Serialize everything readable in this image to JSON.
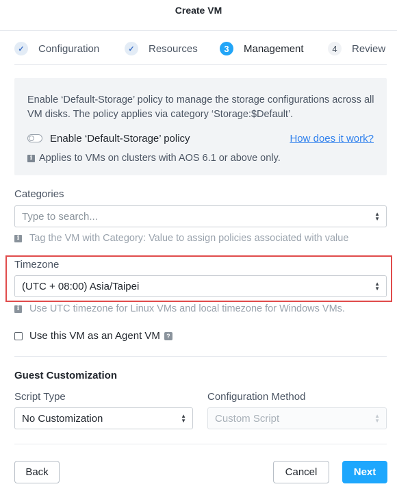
{
  "dialog": {
    "title": "Create VM"
  },
  "steps": [
    {
      "number": "✓",
      "label": "Configuration",
      "state": "done"
    },
    {
      "number": "✓",
      "label": "Resources",
      "state": "done"
    },
    {
      "number": "3",
      "label": "Management",
      "state": "active"
    },
    {
      "number": "4",
      "label": "Review",
      "state": "pending"
    }
  ],
  "storage_policy": {
    "description": "Enable ‘Default-Storage’ policy to manage the storage configurations across all VM disks. The policy applies via category ‘Storage:$Default’.",
    "toggle_label": "Enable ‘Default-Storage’ policy",
    "toggle_on": false,
    "help_link": "How does it work?",
    "note": "Applies to VMs on clusters with AOS 6.1 or above only."
  },
  "categories": {
    "label": "Categories",
    "placeholder": "Type to search...",
    "hint": "Tag the VM with Category: Value to assign policies associated with value"
  },
  "timezone": {
    "label": "Timezone",
    "value": "(UTC + 08:00) Asia/Taipei",
    "hint": "Use UTC timezone for Linux VMs and local timezone for Windows VMs."
  },
  "agent_vm": {
    "label": "Use this VM as an Agent VM",
    "checked": false
  },
  "guest_customization": {
    "title": "Guest Customization",
    "script_type_label": "Script Type",
    "script_type_value": "No Customization",
    "config_method_label": "Configuration Method",
    "config_method_value": "Custom Script"
  },
  "footer": {
    "back": "Back",
    "cancel": "Cancel",
    "next": "Next"
  },
  "colors": {
    "accent": "#1ea7fd",
    "highlight": "#e04b4b",
    "link": "#2f80ed"
  }
}
